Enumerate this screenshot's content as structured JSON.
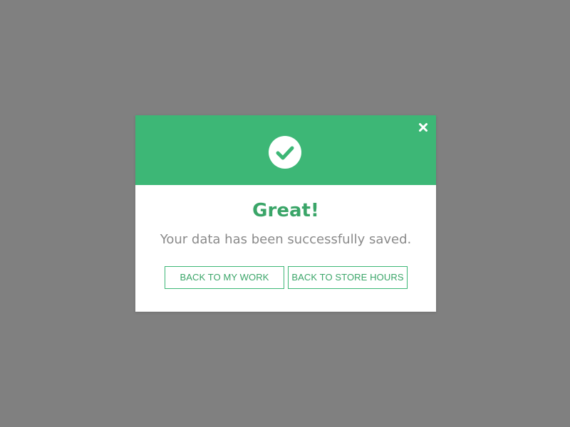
{
  "modal": {
    "title": "Great!",
    "message": "Your data has been successfully saved.",
    "icons": {
      "status": "check-circle-icon",
      "close": "close-icon"
    },
    "buttons": {
      "back_to_work": "BACK TO MY WORK",
      "back_to_store_hours": "BACK TO STORE HOURS"
    }
  },
  "colors": {
    "backdrop": "#808080",
    "header": "#3db776",
    "title": "#3aa568",
    "message": "#8a8a8a",
    "button_border": "#3db776",
    "button_text": "#3aa568",
    "modal_bg": "#ffffff"
  }
}
